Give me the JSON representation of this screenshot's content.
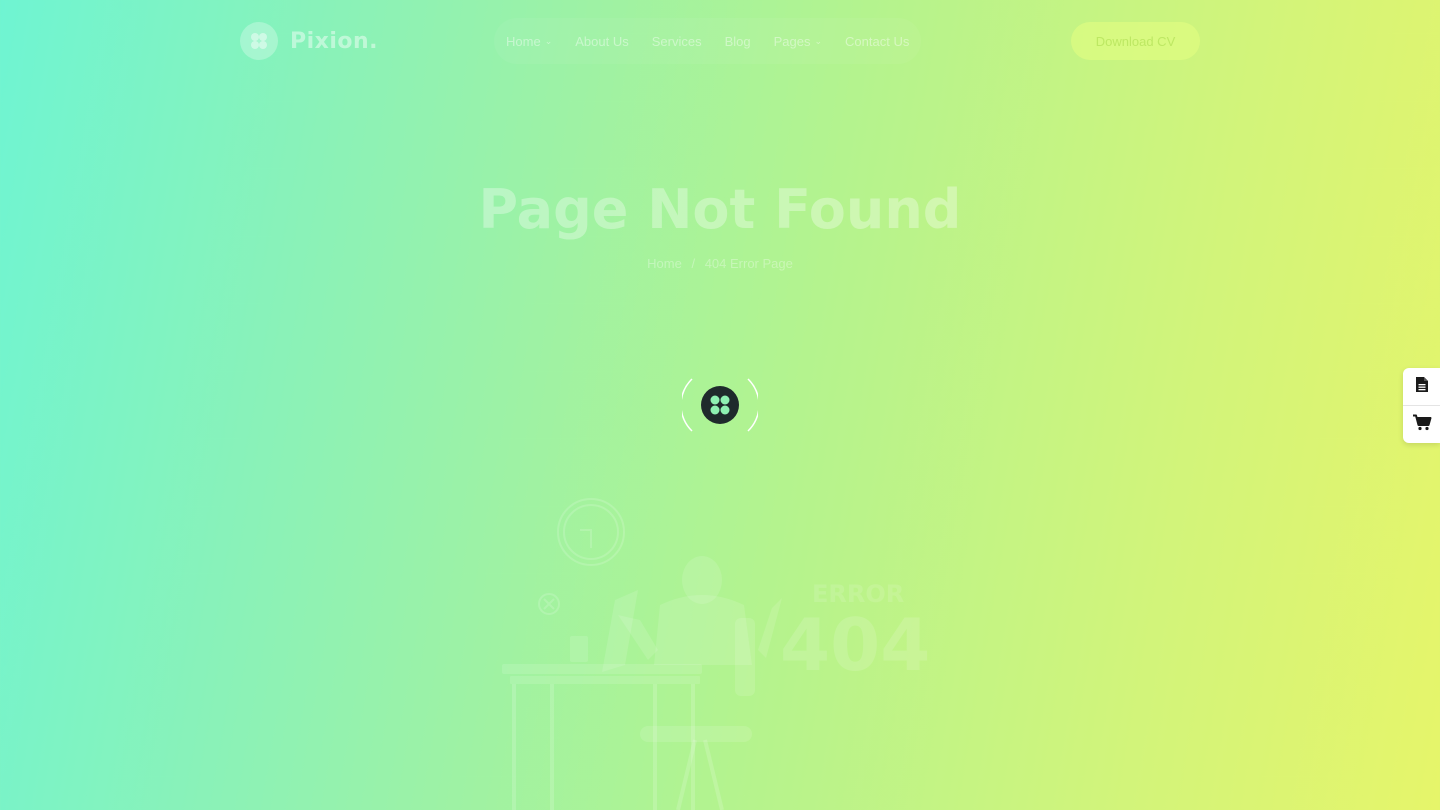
{
  "brand": {
    "name": "Pixion."
  },
  "nav": {
    "items": [
      {
        "label": "Home",
        "dropdown": true
      },
      {
        "label": "About Us",
        "dropdown": false
      },
      {
        "label": "Services",
        "dropdown": false
      },
      {
        "label": "Blog",
        "dropdown": false
      },
      {
        "label": "Pages",
        "dropdown": true
      },
      {
        "label": "Contact Us",
        "dropdown": false
      }
    ],
    "cta_label": "Download CV"
  },
  "hero": {
    "title": "Page Not Found",
    "breadcrumb": {
      "home": "Home",
      "separator": "/",
      "current": "404 Error Page"
    }
  },
  "illustration": {
    "error_word": "ERROR",
    "error_code": "404"
  },
  "side_dock": {
    "icons": [
      "document-icon",
      "cart-icon"
    ]
  },
  "colors": {
    "loader_bg": "#1f2a2c",
    "loader_mark": "#8ef0b2",
    "gradient_start": "#6ff4d2",
    "gradient_end": "#e6f56a"
  }
}
